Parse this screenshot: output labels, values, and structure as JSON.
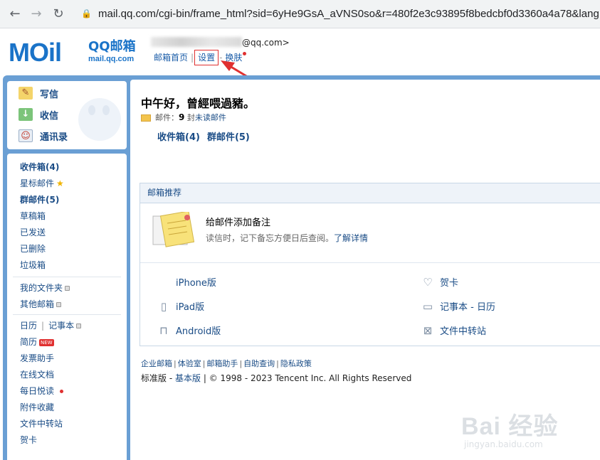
{
  "browser": {
    "url": "mail.qq.com/cgi-bin/frame_html?sid=6yHe9GsA_aVNS0so&r=480f2e3c93895f8bedcbf0d3360a4a78&lang"
  },
  "header": {
    "logo_text": "MOil",
    "logo_title": "QQ邮箱",
    "logo_sub": "mail.qq.com",
    "account_suffix": "@qq.com>",
    "nav": {
      "home": "邮箱首页",
      "settings": "设置",
      "dash": "-",
      "skin": "换肤"
    }
  },
  "sidebar": {
    "actions": [
      {
        "label": "写信",
        "icon": "write-icon"
      },
      {
        "label": "收信",
        "icon": "receive-icon"
      },
      {
        "label": "通讯录",
        "icon": "contacts-icon"
      }
    ],
    "folders": {
      "inbox": "收件箱(4)",
      "starred": "星标邮件",
      "group": "群邮件(5)",
      "drafts": "草稿箱",
      "sent": "已发送",
      "deleted": "已删除",
      "spam": "垃圾箱",
      "my_folders": "我的文件夹",
      "other_mailbox": "其他邮箱",
      "calendar": "日历",
      "pipe": "|",
      "notes": "记事本",
      "resume": "简历",
      "new_badge": "NEW",
      "invoice": "发票助手",
      "docs": "在线文档",
      "daily": "每日悦读",
      "attachments": "附件收藏",
      "transfer": "文件中转站",
      "card": "贺卡"
    }
  },
  "main": {
    "greeting": "中午好，曾經喂過豬。",
    "mail_label": "邮件：",
    "unread_count": "9",
    "unread_unit": "封",
    "unread_text": "未读邮件",
    "inbox_link": "收件箱(4)",
    "group_link": "群邮件(5)",
    "recommend": {
      "title": "邮箱推荐",
      "tip_title": "给邮件添加备注",
      "tip_desc": "读信时，记下备忘方便日后查阅。",
      "tip_link": "了解详情",
      "apps": [
        {
          "label": "iPhone版",
          "icon": "apple-icon"
        },
        {
          "label": "贺卡",
          "icon": "heart-icon"
        },
        {
          "label": "iPad版",
          "icon": "tablet-icon"
        },
        {
          "label": "记事本 - 日历",
          "icon": "calendar-icon"
        },
        {
          "label": "Android版",
          "icon": "android-icon"
        },
        {
          "label": "文件中转站",
          "icon": "transfer-icon"
        }
      ]
    },
    "footer": {
      "links": [
        "企业邮箱",
        "体验室",
        "邮箱助手",
        "自助查询",
        "隐私政策"
      ],
      "sep": "|",
      "edition": "标准版",
      "dash": "-",
      "basic": "基本版",
      "copyright": "| © 1998 - 2023 Tencent Inc. All Rights Reserved"
    }
  },
  "watermark": {
    "text": "Bai 经验",
    "url": "jingyan.baidu.com"
  }
}
